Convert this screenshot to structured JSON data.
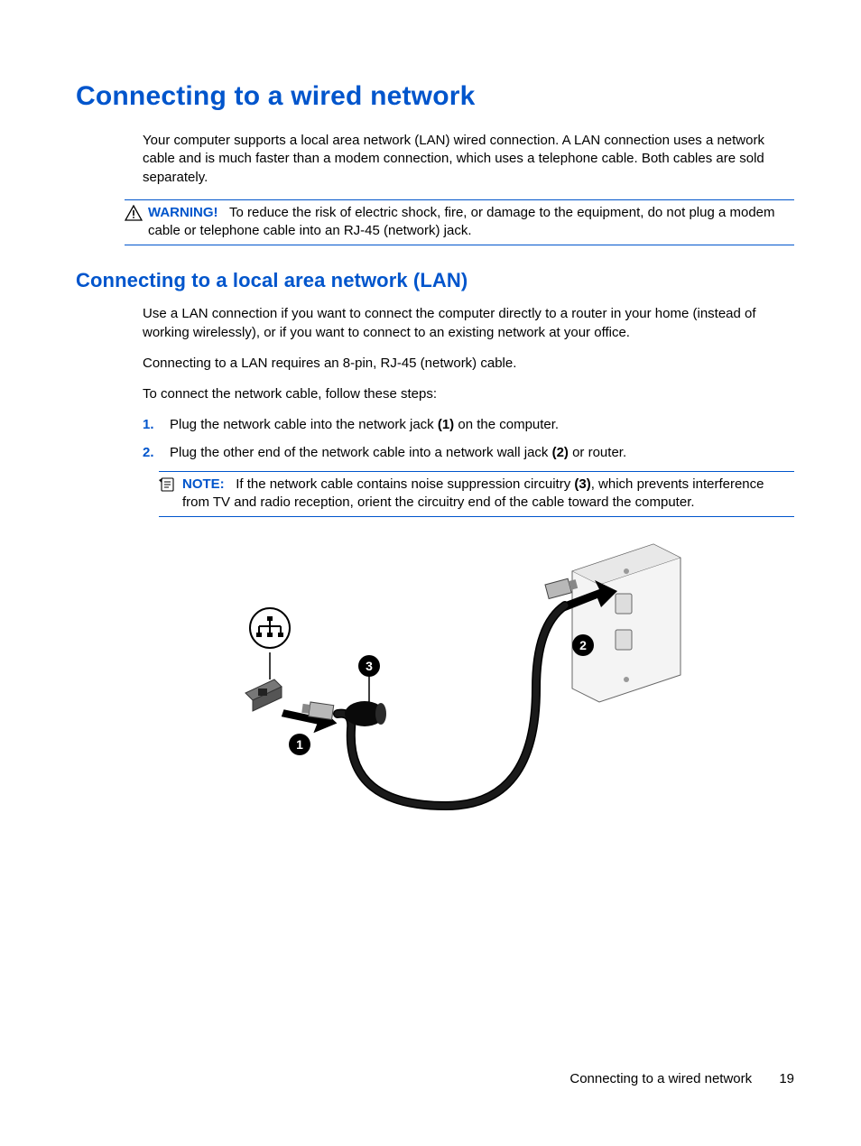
{
  "heading_main": "Connecting to a wired network",
  "intro": "Your computer supports a local area network (LAN) wired connection. A LAN connection uses a network cable and is much faster than a modem connection, which uses a telephone cable. Both cables are sold separately.",
  "warning": {
    "label": "WARNING!",
    "text": "To reduce the risk of electric shock, fire, or damage to the equipment, do not plug a modem cable or telephone cable into an RJ-45 (network) jack."
  },
  "heading_sub": "Connecting to a local area network (LAN)",
  "para_use_lan": "Use a LAN connection if you want to connect the computer directly to a router in your home (instead of working wirelessly), or if you want to connect to an existing network at your office.",
  "para_requires": "Connecting to a LAN requires an 8-pin, RJ-45 (network) cable.",
  "para_follow": "To connect the network cable, follow these steps:",
  "steps": {
    "s1": {
      "num": "1.",
      "before": "Plug the network cable into the network jack ",
      "bold": "(1)",
      "after": " on the computer."
    },
    "s2": {
      "num": "2.",
      "before": "Plug the other end of the network cable into a network wall jack ",
      "bold": "(2)",
      "after": " or router."
    }
  },
  "note": {
    "label": "NOTE:",
    "before": "If the network cable contains noise suppression circuitry ",
    "bold": "(3)",
    "after": ", which prevents interference from TV and radio reception, orient the circuitry end of the cable toward the computer."
  },
  "illustration": {
    "callout_1": "1",
    "callout_2": "2",
    "callout_3": "3"
  },
  "footer": {
    "title": "Connecting to a wired network",
    "page": "19"
  }
}
